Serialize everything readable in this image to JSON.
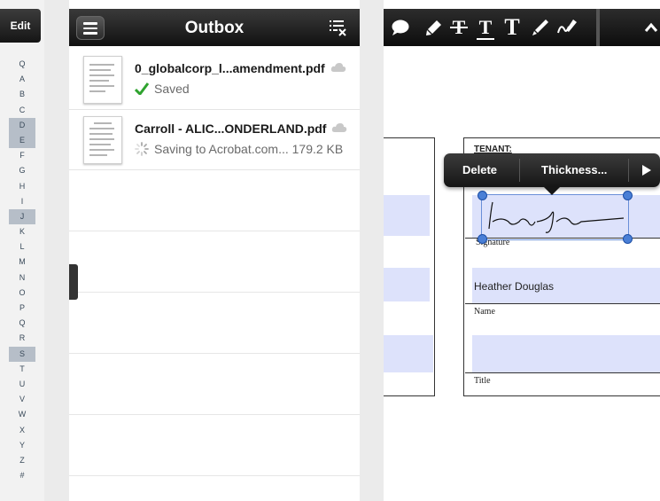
{
  "index_panel": {
    "edit_label": "Edit",
    "letters": [
      "Q",
      "A",
      "B",
      "C",
      "D",
      "E",
      "F",
      "G",
      "H",
      "I",
      "J",
      "K",
      "L",
      "M",
      "N",
      "O",
      "P",
      "Q",
      "R",
      "S",
      "T",
      "U",
      "V",
      "W",
      "X",
      "Y",
      "Z",
      "#"
    ],
    "highlighted": [
      "D",
      "E",
      "J",
      "S"
    ]
  },
  "outbox": {
    "title": "Outbox",
    "files": [
      {
        "name": "0_globalcorp_l...amendment.pdf",
        "status": "Saved",
        "status_icon": "checkmark-icon"
      },
      {
        "name": "Carroll - ALIC...ONDERLAND.pdf",
        "status": "Saving to Acrobat.com... 179.2 KB",
        "status_icon": "spinner-icon"
      }
    ]
  },
  "document": {
    "toolbar_tools": [
      "comment-icon",
      "highlight-icon",
      "strikethrough-icon",
      "underline-icon",
      "text-icon",
      "pen-icon",
      "signature-icon",
      "collapse-chevron-icon"
    ],
    "tenant_label": "TENANT:",
    "popup": {
      "delete": "Delete",
      "thickness": "Thickness..."
    },
    "signature_label": "Signature",
    "name_value": "Heather Douglas",
    "name_label": "Name",
    "title_label": "Title"
  },
  "colors": {
    "fill": "#dde2fb",
    "accent_check": "#2fa32f",
    "selection": "#4a7fd6"
  }
}
